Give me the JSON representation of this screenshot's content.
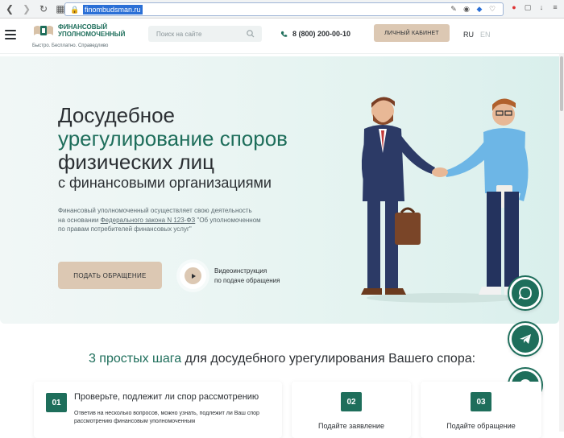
{
  "browser": {
    "url": "finombudsman.ru"
  },
  "header": {
    "logo_title_line1": "ФИНАНСОВЫЙ",
    "logo_title_line2": "УПОЛНОМОЧЕННЫЙ",
    "logo_tagline": "Быстро. Бесплатно. Справедливо",
    "search_placeholder": "Поиск на сайте",
    "phone": "8 (800) 200-00-10",
    "cabinet_label": "ЛИЧНЫЙ КАБИНЕТ",
    "lang_ru": "RU",
    "lang_en": "EN"
  },
  "hero": {
    "title_line1": "Досудебное",
    "title_line2": "урегулирование споров",
    "title_line3": "физических лиц",
    "subtitle": "с финансовыми организациями",
    "desc_line1": "Финансовый уполномоченный осуществляет свою деятельность",
    "desc_prefix": "на основании ",
    "desc_link": "Федерального закона N 123-ФЗ",
    "desc_suffix": " \"Об уполномоченном",
    "desc_line3": "по правам потребителей финансовых услуг\"",
    "appeal_button": "ПОДАТЬ ОБРАЩЕНИЕ",
    "video_line1": "Видеоинструкция",
    "video_line2": "по подаче обращения"
  },
  "steps": {
    "title_green": "3 простых шага",
    "title_rest": " для досудебного урегулирования Вашего спора:",
    "cards": [
      {
        "number": "01",
        "title": "Проверьте, подлежит ли спор рассмотрению",
        "text": "Ответив на несколько вопросов, можно узнать, подлежит ли Ваш спор рассмотрению финансовым уполномоченным"
      },
      {
        "number": "02",
        "label": "Подайте заявление"
      },
      {
        "number": "03",
        "label": "Подайте обращение"
      }
    ]
  },
  "colors": {
    "accent": "#1e6e5b",
    "beige": "#dcc8b3",
    "hero_bg": "#e4f3f0"
  }
}
